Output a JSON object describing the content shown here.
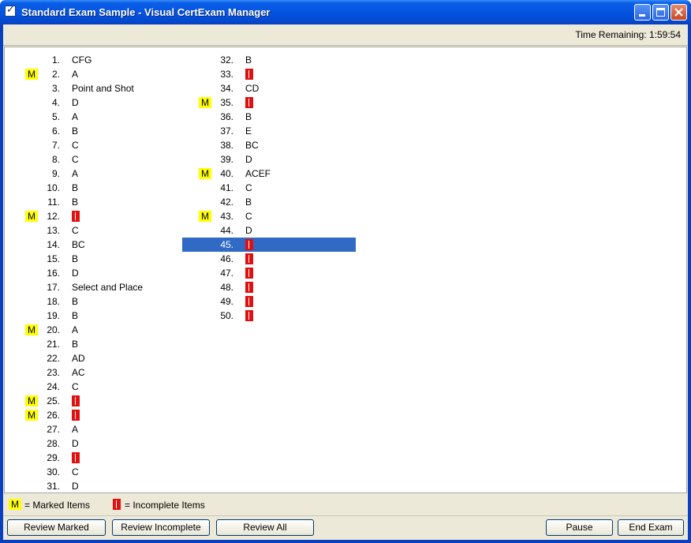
{
  "window": {
    "title": "Standard Exam Sample - Visual CertExam Manager"
  },
  "timer": {
    "text": "Time Remaining: 1:59:54"
  },
  "items_col1": [
    {
      "num": "1.",
      "answer": "CFG",
      "marked": false,
      "incomplete": false
    },
    {
      "num": "2.",
      "answer": "A",
      "marked": true,
      "incomplete": false
    },
    {
      "num": "3.",
      "answer": "Point and Shot",
      "marked": false,
      "incomplete": false
    },
    {
      "num": "4.",
      "answer": "D",
      "marked": false,
      "incomplete": false
    },
    {
      "num": "5.",
      "answer": "A",
      "marked": false,
      "incomplete": false
    },
    {
      "num": "6.",
      "answer": "B",
      "marked": false,
      "incomplete": false
    },
    {
      "num": "7.",
      "answer": "C",
      "marked": false,
      "incomplete": false
    },
    {
      "num": "8.",
      "answer": "C",
      "marked": false,
      "incomplete": false
    },
    {
      "num": "9.",
      "answer": "A",
      "marked": false,
      "incomplete": false
    },
    {
      "num": "10.",
      "answer": "B",
      "marked": false,
      "incomplete": false
    },
    {
      "num": "11.",
      "answer": "B",
      "marked": false,
      "incomplete": false
    },
    {
      "num": "12.",
      "answer": "",
      "marked": true,
      "incomplete": true
    },
    {
      "num": "13.",
      "answer": "C",
      "marked": false,
      "incomplete": false
    },
    {
      "num": "14.",
      "answer": "BC",
      "marked": false,
      "incomplete": false
    },
    {
      "num": "15.",
      "answer": "B",
      "marked": false,
      "incomplete": false
    },
    {
      "num": "16.",
      "answer": "D",
      "marked": false,
      "incomplete": false
    },
    {
      "num": "17.",
      "answer": "Select and Place",
      "marked": false,
      "incomplete": false
    },
    {
      "num": "18.",
      "answer": "B",
      "marked": false,
      "incomplete": false
    },
    {
      "num": "19.",
      "answer": "B",
      "marked": false,
      "incomplete": false
    },
    {
      "num": "20.",
      "answer": "A",
      "marked": true,
      "incomplete": false
    },
    {
      "num": "21.",
      "answer": "B",
      "marked": false,
      "incomplete": false
    },
    {
      "num": "22.",
      "answer": "AD",
      "marked": false,
      "incomplete": false
    },
    {
      "num": "23.",
      "answer": "AC",
      "marked": false,
      "incomplete": false
    },
    {
      "num": "24.",
      "answer": "C",
      "marked": false,
      "incomplete": false
    },
    {
      "num": "25.",
      "answer": "",
      "marked": true,
      "incomplete": true
    },
    {
      "num": "26.",
      "answer": "",
      "marked": true,
      "incomplete": true
    },
    {
      "num": "27.",
      "answer": "A",
      "marked": false,
      "incomplete": false
    },
    {
      "num": "28.",
      "answer": "D",
      "marked": false,
      "incomplete": false
    },
    {
      "num": "29.",
      "answer": "",
      "marked": false,
      "incomplete": true
    },
    {
      "num": "30.",
      "answer": "C",
      "marked": false,
      "incomplete": false
    },
    {
      "num": "31.",
      "answer": "D",
      "marked": false,
      "incomplete": false
    }
  ],
  "items_col2": [
    {
      "num": "32.",
      "answer": "B",
      "marked": false,
      "incomplete": false
    },
    {
      "num": "33.",
      "answer": "",
      "marked": false,
      "incomplete": true
    },
    {
      "num": "34.",
      "answer": "CD",
      "marked": false,
      "incomplete": false
    },
    {
      "num": "35.",
      "answer": "",
      "marked": true,
      "incomplete": true
    },
    {
      "num": "36.",
      "answer": "B",
      "marked": false,
      "incomplete": false
    },
    {
      "num": "37.",
      "answer": "E",
      "marked": false,
      "incomplete": false
    },
    {
      "num": "38.",
      "answer": "BC",
      "marked": false,
      "incomplete": false
    },
    {
      "num": "39.",
      "answer": "D",
      "marked": false,
      "incomplete": false
    },
    {
      "num": "40.",
      "answer": "ACEF",
      "marked": true,
      "incomplete": false
    },
    {
      "num": "41.",
      "answer": "C",
      "marked": false,
      "incomplete": false
    },
    {
      "num": "42.",
      "answer": "B",
      "marked": false,
      "incomplete": false
    },
    {
      "num": "43.",
      "answer": "C",
      "marked": true,
      "incomplete": false
    },
    {
      "num": "44.",
      "answer": "D",
      "marked": false,
      "incomplete": false
    },
    {
      "num": "45.",
      "answer": "",
      "marked": false,
      "incomplete": true,
      "selected": true
    },
    {
      "num": "46.",
      "answer": "",
      "marked": false,
      "incomplete": true
    },
    {
      "num": "47.",
      "answer": "",
      "marked": false,
      "incomplete": true
    },
    {
      "num": "48.",
      "answer": "",
      "marked": false,
      "incomplete": true
    },
    {
      "num": "49.",
      "answer": "",
      "marked": false,
      "incomplete": true
    },
    {
      "num": "50.",
      "answer": "",
      "marked": false,
      "incomplete": true
    }
  ],
  "marker": {
    "marked_letter": "M",
    "marked_color": "#ffff00",
    "incomplete_color": "#e01010",
    "selected_color": "#316ac5"
  },
  "legend": {
    "marked_text": "= Marked Items",
    "incomplete_text": "= Incomplete Items"
  },
  "buttons": {
    "review_marked": "Review Marked",
    "review_incomplete": "Review Incomplete",
    "review_all": "Review All",
    "pause": "Pause",
    "end_exam": "End Exam"
  }
}
